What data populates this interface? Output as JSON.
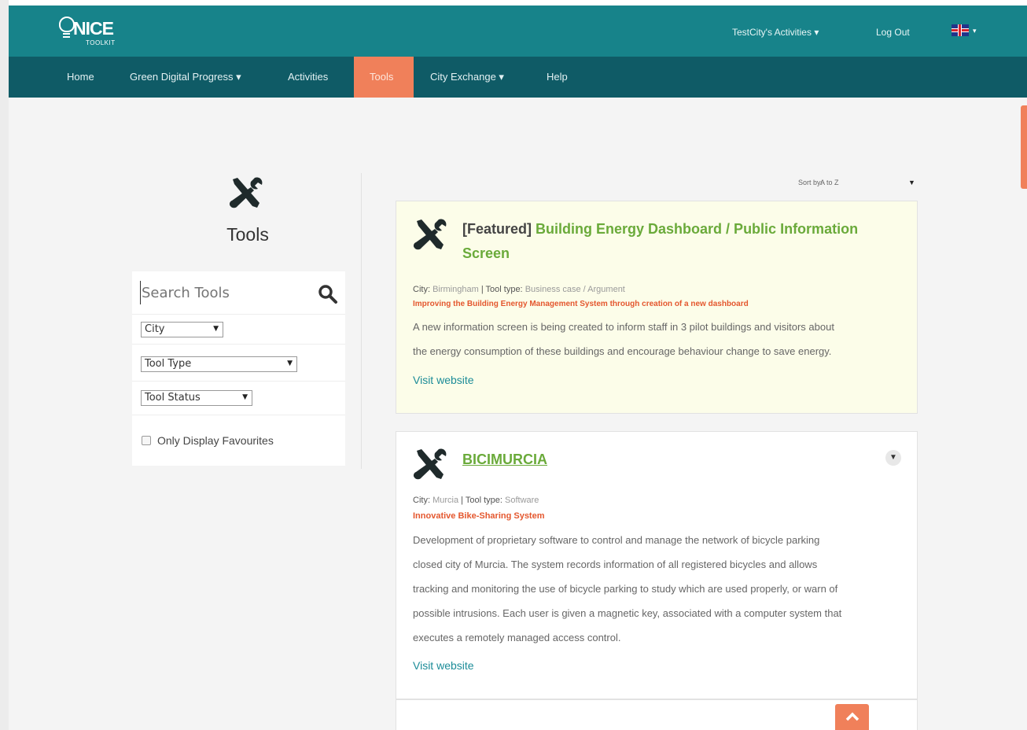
{
  "brand": {
    "logo_word": "NICE",
    "logo_sub": "TOOLKIT"
  },
  "topbar": {
    "activities_menu": "TestCity's Activities ▾",
    "logout": "Log Out",
    "flag_caret": "▾"
  },
  "nav": {
    "items": [
      "Home",
      "Green Digital Progress ▾",
      "Activities",
      "Tools",
      "City Exchange ▾",
      "Help"
    ],
    "active": "Tools"
  },
  "sidebar": {
    "title": "Tools",
    "search_placeholder": "Search Tools",
    "city_select": "City",
    "tool_type_select": "Tool Type",
    "tool_status_select": "Tool Status",
    "favourites_label": "Only Display Favourites"
  },
  "sort": {
    "label": "Sort by:",
    "value": "A to Z"
  },
  "tools": [
    {
      "prefix": "[Featured]",
      "title_line1": "Building Energy Dashboard / Public Information",
      "title_line2": "Screen",
      "city_label": "City:",
      "city": "Birmingham",
      "sep": "|",
      "type_label": "Tool type:",
      "type": "Business case / Argument",
      "subtitle": "Improving the Building Energy Management System through creation of a new dashboard",
      "desc_lines": [
        "A new information screen is being created to inform staff in 3 pilot buildings and visitors about",
        "the energy consumption of these buildings and encourage behaviour change to save energy."
      ],
      "visit": "Visit website"
    },
    {
      "title": "BICIMURCIA",
      "city_label": "City:",
      "city": "Murcia",
      "sep": "|",
      "type_label": "Tool type:",
      "type": "Software",
      "subtitle": "Innovative Bike-Sharing System",
      "desc_lines": [
        "Development of proprietary software to control and manage the network of bicycle parking",
        "closed city of Murcia. The system records information of all registered bicycles and allows",
        "tracking and monitoring the use of bicycle parking to study which are used properly, or warn of",
        "possible intrusions. Each user is given a magnetic key, associated with a computer system that",
        "executes a remotely managed access control."
      ],
      "visit": "Visit website"
    }
  ],
  "colors": {
    "topbar": "#17838a",
    "navbar": "#0f5b66",
    "accent": "#f0805a",
    "title_green": "#6aaa3a",
    "subtitle_red": "#e4572e",
    "link_teal": "#1c8c98",
    "featured_bg": "#fcfde9"
  },
  "icons": {
    "tool": "wrench-screwdriver-icon",
    "search": "search-icon",
    "expand": "chevron-down-icon",
    "scroll_top": "chevron-up-icon",
    "language": "uk-flag-icon"
  }
}
